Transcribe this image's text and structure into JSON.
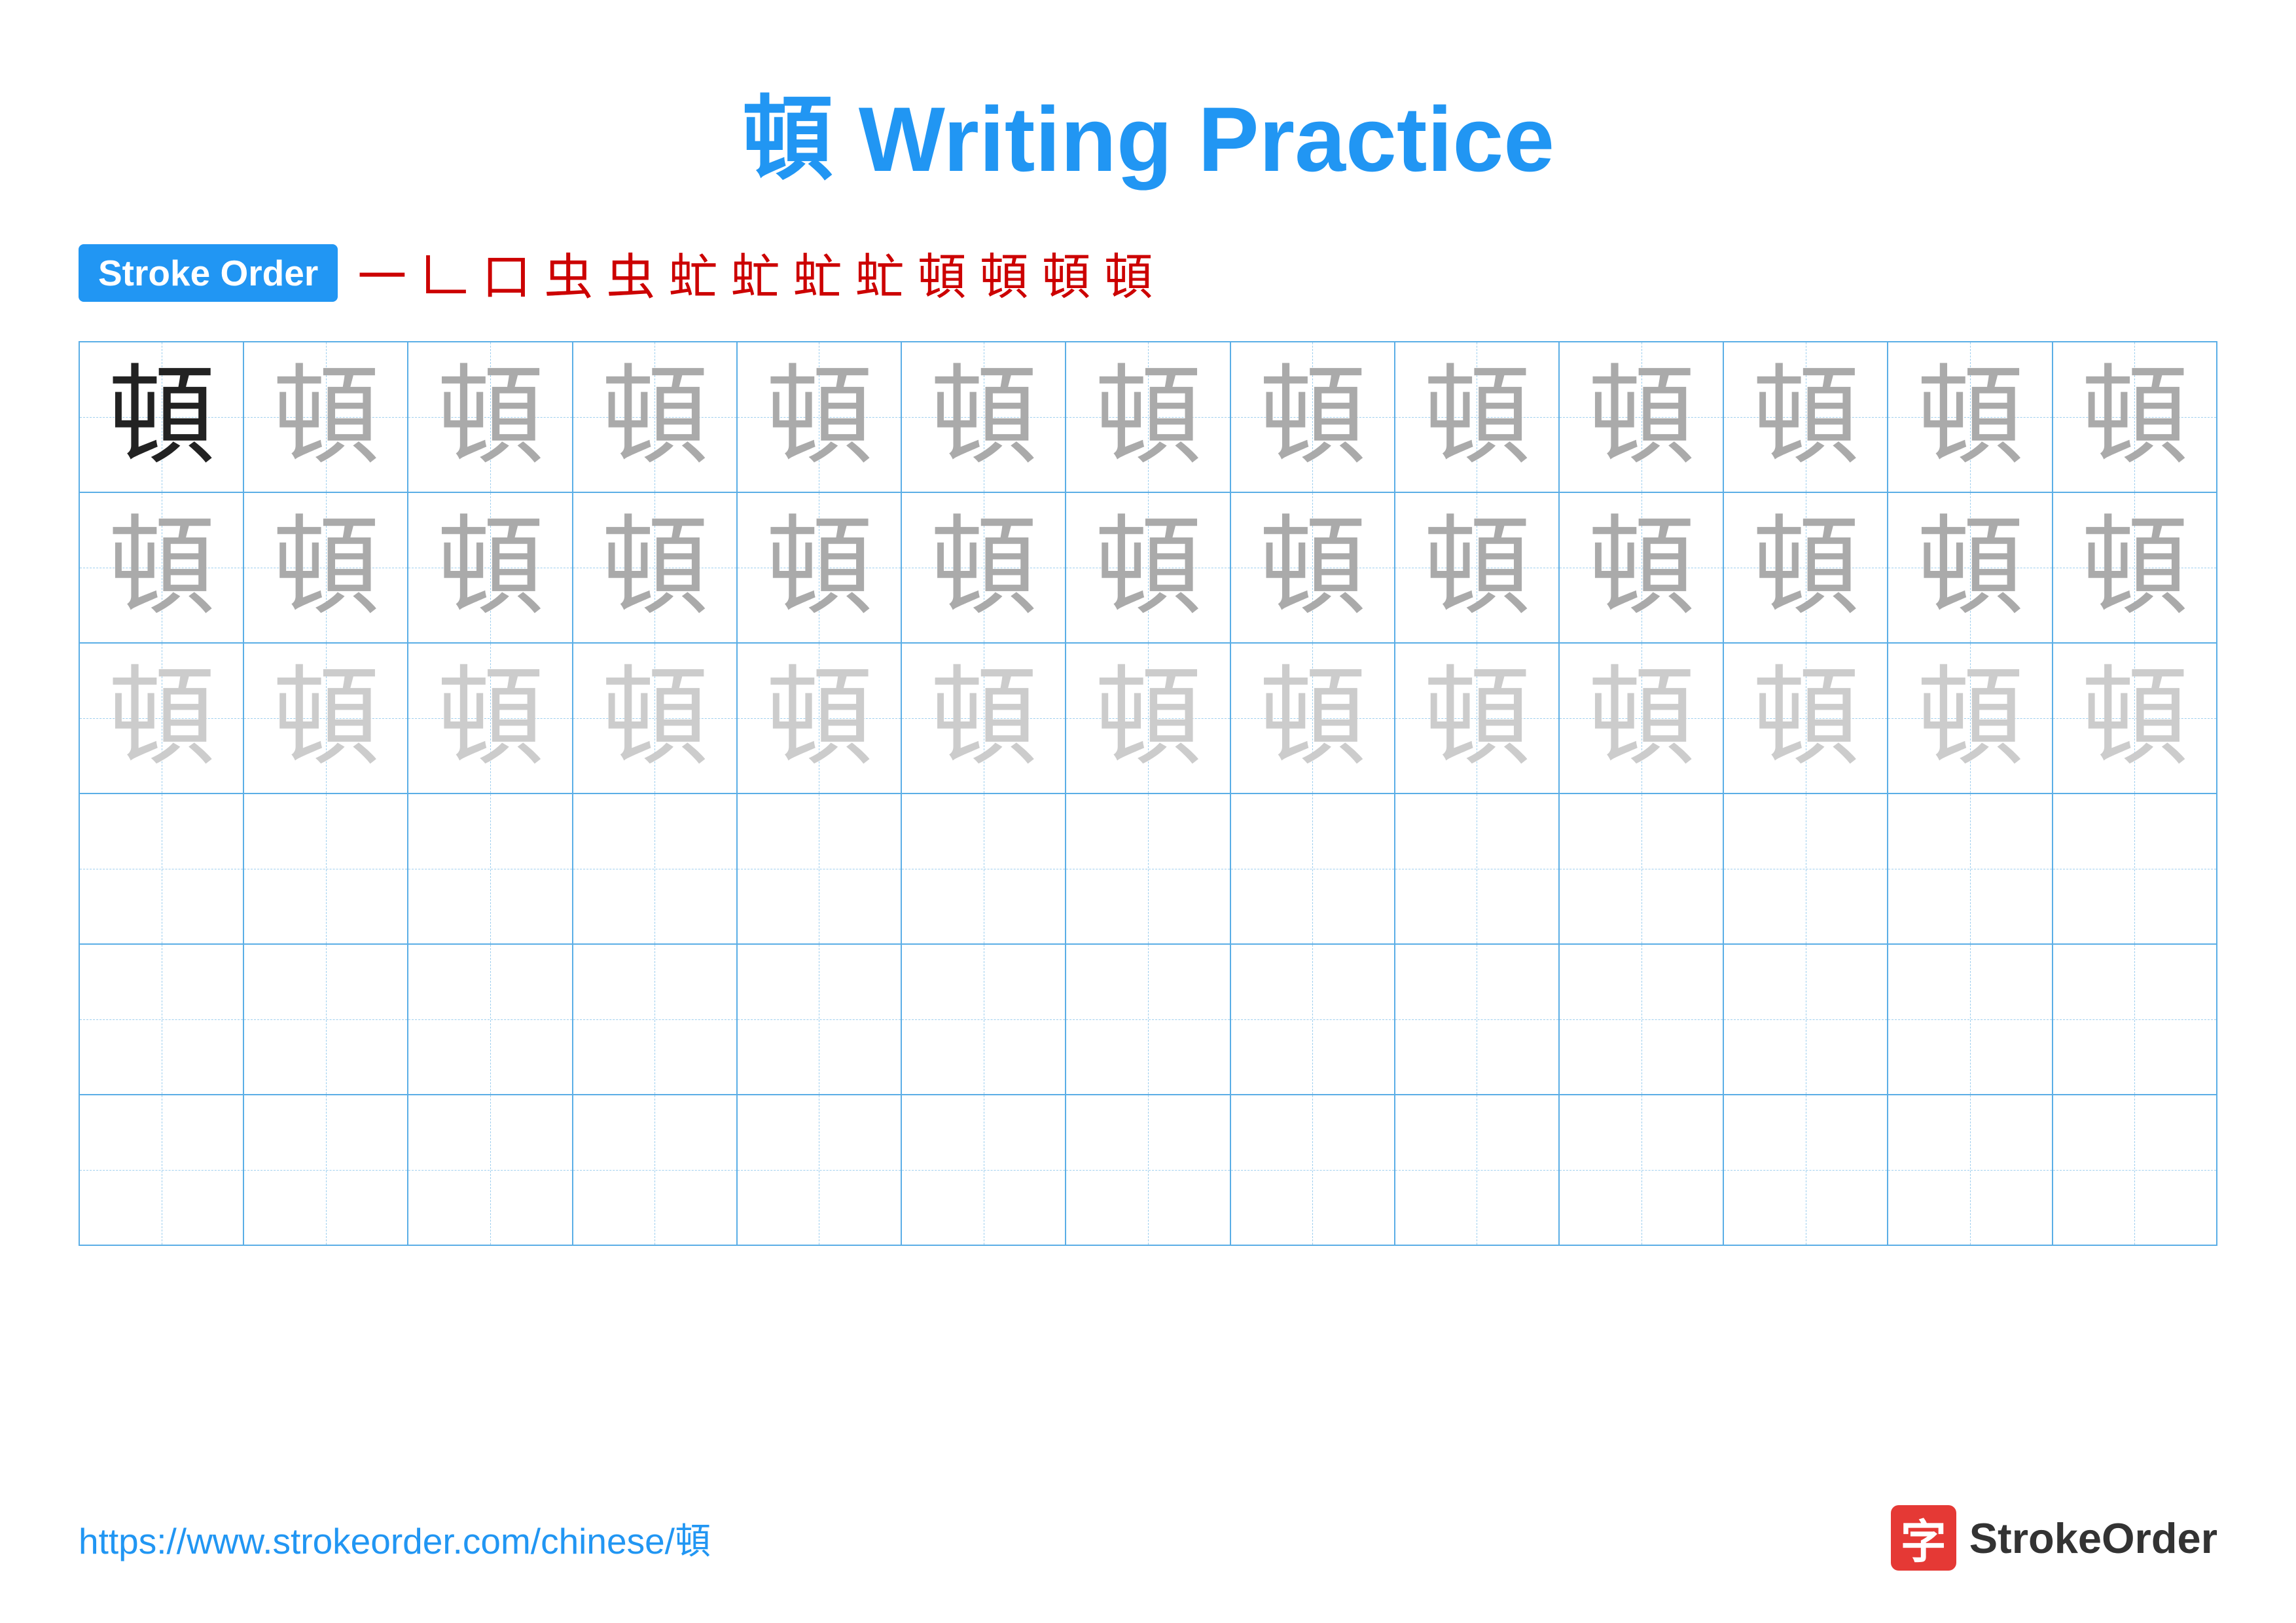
{
  "title": "頓 Writing Practice",
  "stroke_order_badge": "Stroke Order",
  "stroke_steps": [
    "一",
    "𠃊",
    "口",
    "虫",
    "虫",
    "虫",
    "虻",
    "虻",
    "虻",
    "頓",
    "頓",
    "頓",
    "頓"
  ],
  "character": "頓",
  "grid": {
    "rows": 6,
    "cols": 13,
    "row_types": [
      "dark-then-medium",
      "medium",
      "light",
      "empty",
      "empty",
      "empty"
    ]
  },
  "footer": {
    "url": "https://www.strokeorder.com/chinese/頓",
    "brand": "StrokeOrder"
  }
}
